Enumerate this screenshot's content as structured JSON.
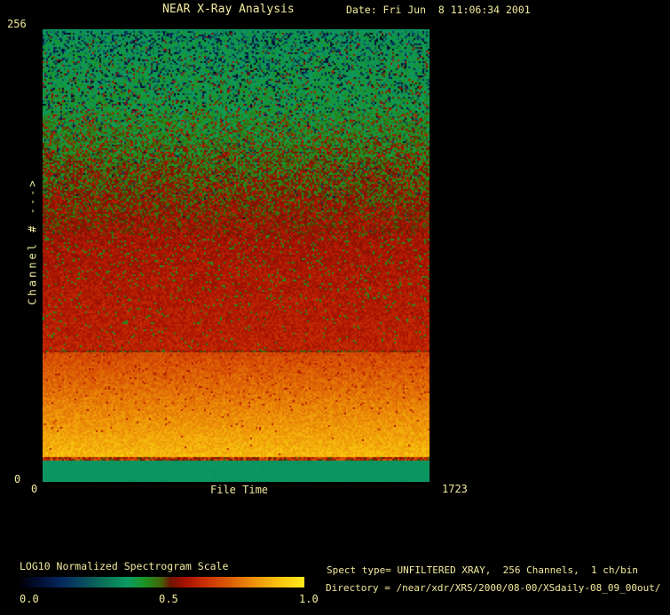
{
  "window": {
    "background": "#000000",
    "text_color": "#f2ea9c"
  },
  "header": {
    "title": "NEAR X-Ray Analysis",
    "date": "Date: Fri Jun  8 11:06:34 2001"
  },
  "chart_data": {
    "type": "heatmap",
    "title": "NEAR X-Ray Analysis",
    "xlabel": "File Time",
    "ylabel": "Channel # --->",
    "x_range": [
      0,
      1723
    ],
    "y_range": [
      0,
      256
    ],
    "x_tick_labels": {
      "min": "0",
      "max": "1723"
    },
    "y_tick_labels": {
      "min": "0",
      "max": "256"
    },
    "description": "Log10-normalized X-ray spectrogram: channel number (0-256) vs file time (0-1723); noisy green with dark blue speckles at high channels, transitioning through speckled green/red to uniform red mid-channels, a bright orange band brightening to yellow near low channels, and a solid green strip at channels 0-12",
    "bands": [
      {
        "channels": [
          254,
          256
        ],
        "value": 0.37,
        "appearance": "solid green line at top edge"
      },
      {
        "channels": [
          208,
          254
        ],
        "value_range": [
          0.05,
          0.45
        ],
        "appearance": "noisy green with dark blue/black speckles"
      },
      {
        "channels": [
          139,
          208
        ],
        "value_range": [
          0.35,
          0.62
        ],
        "appearance": "speckled green-to-red transition"
      },
      {
        "channels": [
          74,
          139
        ],
        "value_range": [
          0.55,
          0.64
        ],
        "appearance": "mostly uniform red with sparse green flecks"
      },
      {
        "channels": [
          13,
          74
        ],
        "value_range": [
          0.7,
          0.9
        ],
        "appearance": "bright orange band brightening to yellow at bottom"
      },
      {
        "channels": [
          0,
          13
        ],
        "value": 0.37,
        "appearance": "solid green strip"
      }
    ],
    "colorbar": {
      "label": "LOG10 Normalized Spectrogram Scale",
      "tick_labels": [
        "0.0",
        "0.5",
        "1.0"
      ],
      "stops": [
        {
          "pos": 0.0,
          "color": "#000006"
        },
        {
          "pos": 0.07,
          "color": "#020e34"
        },
        {
          "pos": 0.15,
          "color": "#06295e"
        },
        {
          "pos": 0.22,
          "color": "#084a5e"
        },
        {
          "pos": 0.3,
          "color": "#0a7457"
        },
        {
          "pos": 0.38,
          "color": "#0c9a61"
        },
        {
          "pos": 0.44,
          "color": "#1b9422"
        },
        {
          "pos": 0.5,
          "color": "#455f05"
        },
        {
          "pos": 0.53,
          "color": "#6f1403"
        },
        {
          "pos": 0.58,
          "color": "#a51102"
        },
        {
          "pos": 0.65,
          "color": "#c92e03"
        },
        {
          "pos": 0.74,
          "color": "#dc5e05"
        },
        {
          "pos": 0.83,
          "color": "#ee9508"
        },
        {
          "pos": 0.92,
          "color": "#f9c90f"
        },
        {
          "pos": 1.0,
          "color": "#ffeb1e"
        }
      ]
    },
    "render": {
      "cell": 2,
      "seed": 1337,
      "zones": [
        {
          "y0": 0.0,
          "y1": 0.005,
          "base": [
            0.37,
            0.37
          ],
          "noise": 0.004
        },
        {
          "y0": 0.005,
          "y1": 0.185,
          "base": [
            0.385,
            0.415
          ],
          "noise": 0.05,
          "lo": [
            0.02,
            0.3
          ],
          "lo_p": [
            0.28,
            0.12
          ],
          "hi": [
            0.52,
            0.6
          ],
          "hi_p": [
            0.01,
            0.1
          ]
        },
        {
          "y0": 0.185,
          "y1": 0.455,
          "base": [
            0.425,
            0.555
          ],
          "noise": 0.07,
          "lo": [
            0.08,
            0.3
          ],
          "lo_p": [
            0.08,
            0.0
          ],
          "hi": [
            0.54,
            0.63
          ],
          "hi_p": [
            0.12,
            0.28
          ]
        },
        {
          "y0": 0.455,
          "y1": 0.71,
          "base": [
            0.58,
            0.62
          ],
          "noise": 0.038,
          "lo": [
            0.43,
            0.48
          ],
          "lo_p": [
            0.1,
            0.02
          ]
        },
        {
          "y0": 0.71,
          "y1": 0.715,
          "base": [
            0.55,
            0.55
          ],
          "noise": 0.09
        },
        {
          "y0": 0.715,
          "y1": 0.944,
          "base": [
            0.7,
            0.89
          ],
          "noise": 0.04,
          "lo": [
            0.58,
            0.65
          ],
          "lo_p": [
            0.05,
            0.0
          ]
        },
        {
          "y0": 0.944,
          "y1": 0.951,
          "base": [
            0.62,
            0.62
          ],
          "noise": 0.13
        },
        {
          "y0": 0.951,
          "y1": 1.0,
          "base": [
            0.37,
            0.37
          ],
          "noise": 0.006
        }
      ]
    }
  },
  "footer": {
    "spect_line": "Spect type= UNFILTERED XRAY,  256 Channels,  1 ch/bin",
    "directory_line": "Directory = /near/xdr/XRS/2000/08-00/XSdaily-08_09_00out/"
  }
}
